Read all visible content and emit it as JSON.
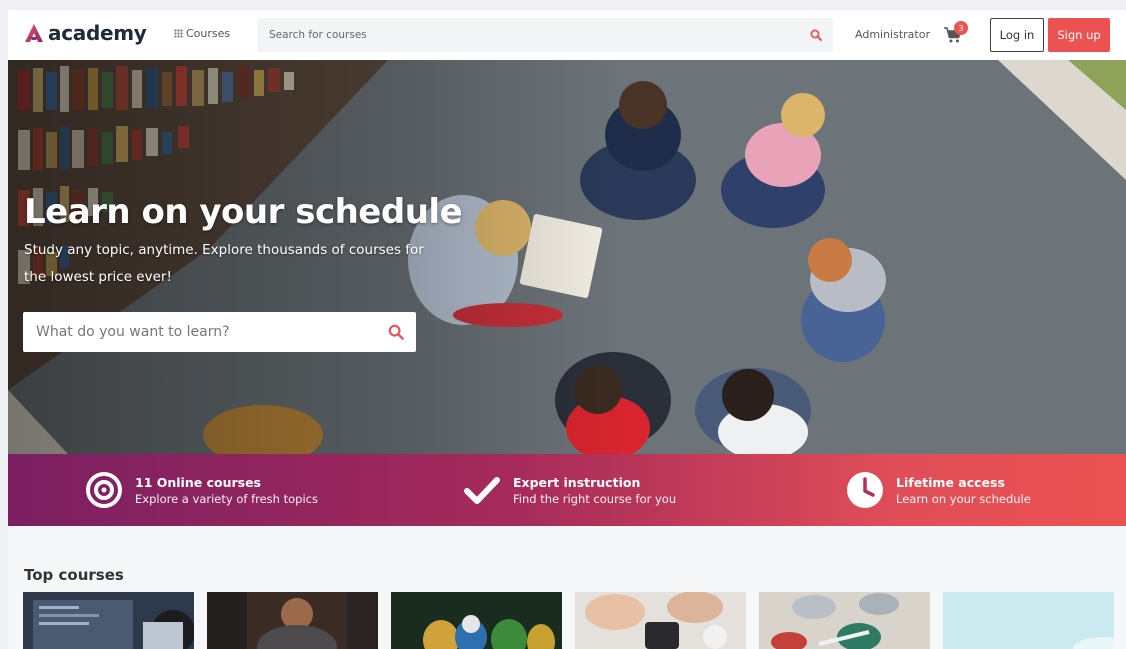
{
  "header": {
    "logo_text": "academy",
    "courses_label": "Courses",
    "search_placeholder": "Search for courses",
    "admin_label": "Administrator",
    "cart_count": "3",
    "login_label": "Log in",
    "signup_label": "Sign up"
  },
  "hero": {
    "title": "Learn on your schedule",
    "subtitle": "Study any topic, anytime. Explore thousands of courses for the lowest price ever!",
    "search_placeholder": "What do you want to learn?"
  },
  "features": [
    {
      "icon": "target-icon",
      "title": "11 Online courses",
      "desc": "Explore a variety of fresh topics"
    },
    {
      "icon": "checkmark-icon",
      "title": "Expert instruction",
      "desc": "Find the right course for you"
    },
    {
      "icon": "clock-icon",
      "title": "Lifetime access",
      "desc": "Learn on your schedule"
    }
  ],
  "top_courses": {
    "title": "Top courses"
  },
  "colors": {
    "brand": "#ec5252",
    "banner_start": "#7b1f62",
    "banner_end": "#ec5252",
    "text_dark": "#1f2a3a"
  }
}
